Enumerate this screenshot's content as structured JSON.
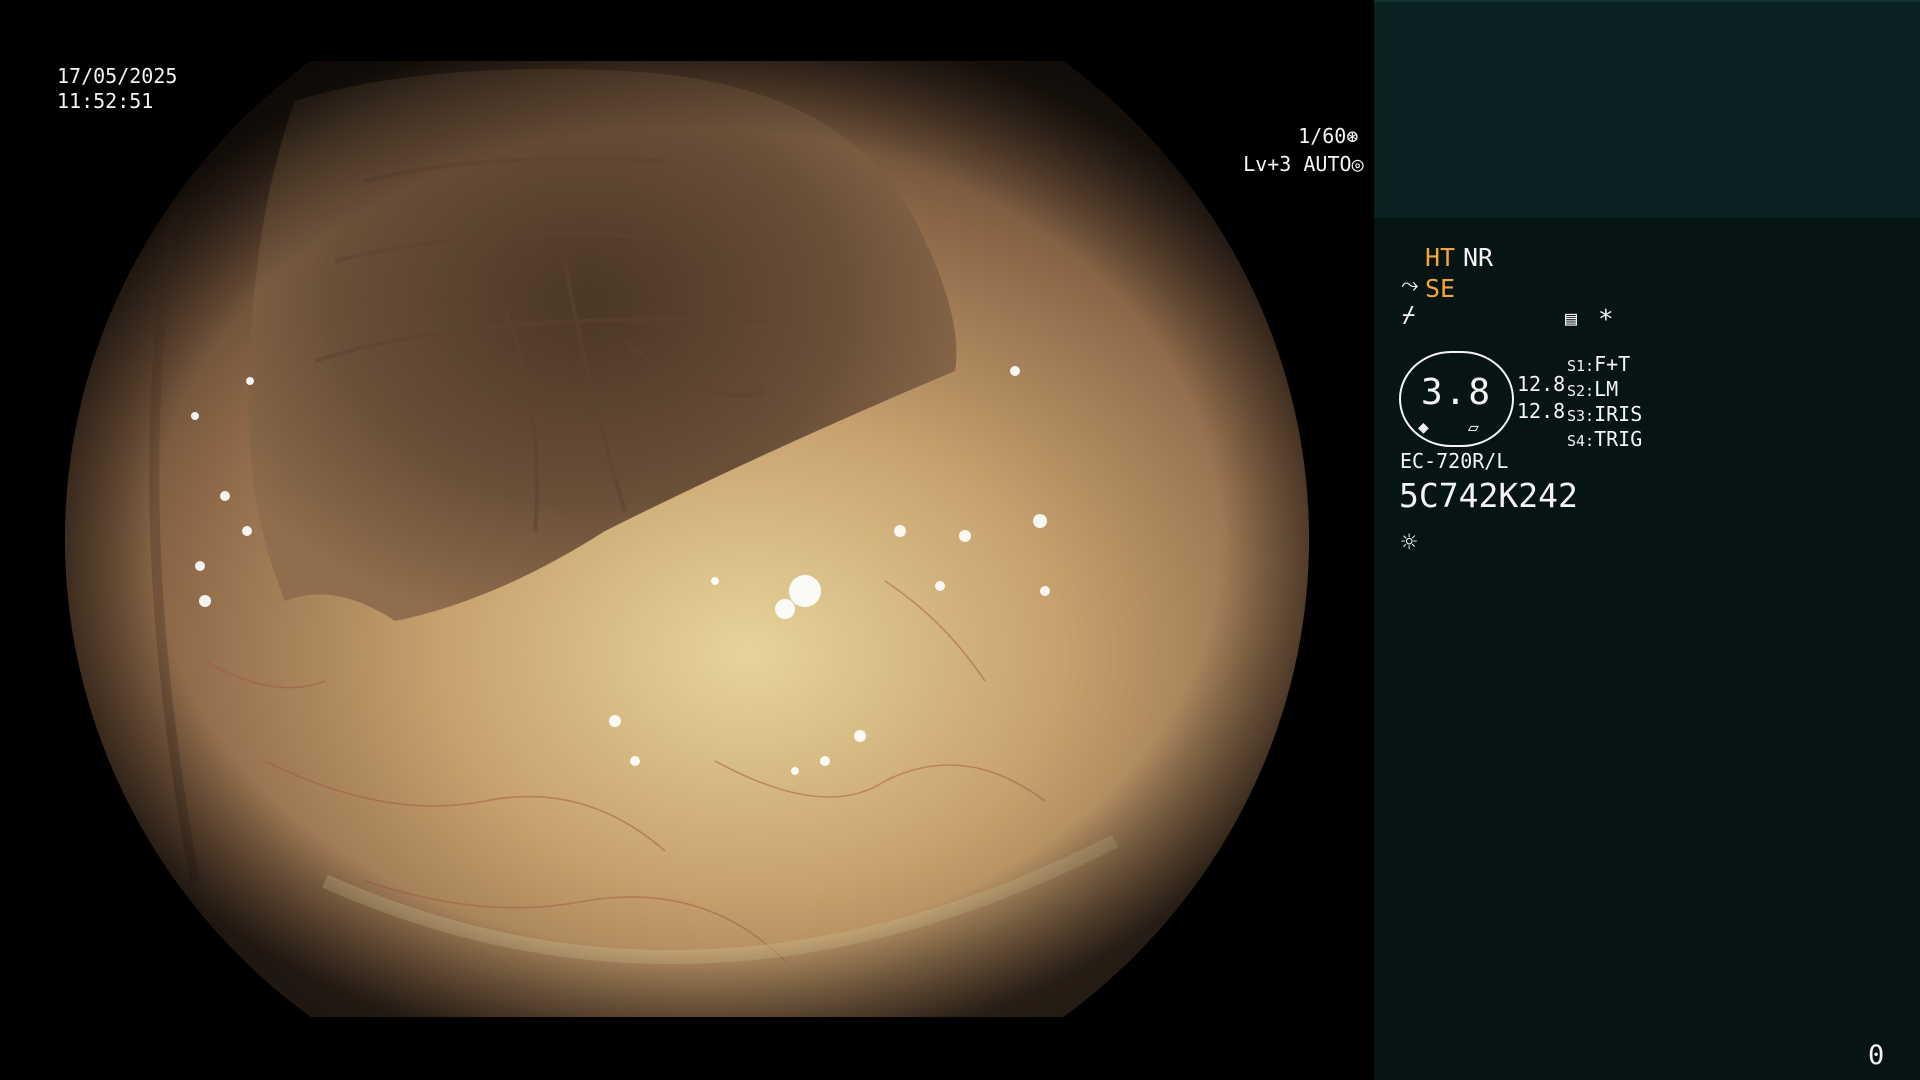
{
  "video": {
    "date": "17/05/2025",
    "time": "11:52:51",
    "shutter": "1/60",
    "level": "Lv+3",
    "mode": "AUTO",
    "shutter_icon": "aperture-icon",
    "mode_icon": "iris-icon"
  },
  "panel": {
    "ht_label": "HT",
    "nr_label": "NR",
    "se_label": "SE",
    "star_label": "*",
    "dial_value": "3.8",
    "left_value_1": "12.8",
    "left_value_2": "12.8",
    "switches": [
      {
        "key": "S1:",
        "value": "F+T"
      },
      {
        "key": "S2:",
        "value": "LM"
      },
      {
        "key": "S3:",
        "value": "IRIS"
      },
      {
        "key": "S4:",
        "value": "TRIG"
      }
    ],
    "scope_model": "EC-720R/L",
    "serial": "5C742K242",
    "counter": "0",
    "colors": {
      "accent": "#f2a63a",
      "panel_bg": "#061513",
      "panel_top_bg": "#0c2121"
    }
  }
}
